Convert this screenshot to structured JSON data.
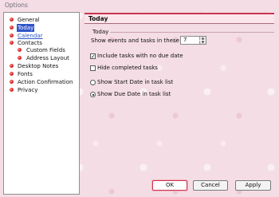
{
  "window": {
    "title": "Options"
  },
  "nav": {
    "items": [
      {
        "label": "General"
      },
      {
        "label": "Today"
      },
      {
        "label": "Calendar"
      },
      {
        "label": "Contacts"
      },
      {
        "label": "Custom Fields"
      },
      {
        "label": "Address Layout"
      },
      {
        "label": "Desktop Notes"
      },
      {
        "label": "Fonts"
      },
      {
        "label": "Action Confirmation"
      },
      {
        "label": "Privacy"
      }
    ],
    "selected": "Today"
  },
  "panel": {
    "title": "Today",
    "group_label": "Today",
    "days": {
      "label": "Show events and tasks in these days:",
      "value": "7"
    },
    "options": [
      {
        "label": "Include tasks with no due date",
        "checked": true
      },
      {
        "label": "Hide completed tasks",
        "checked": false
      }
    ],
    "radios": [
      {
        "label": "Show Start Date in task list",
        "selected": false
      },
      {
        "label": "Show Due Date in task list",
        "selected": true
      }
    ]
  },
  "buttons": {
    "ok": "OK",
    "cancel": "Cancel",
    "apply": "Apply"
  },
  "colors": {
    "accent": "#c8354f",
    "selection": "#2f55c8",
    "background": "#f4dde4"
  }
}
